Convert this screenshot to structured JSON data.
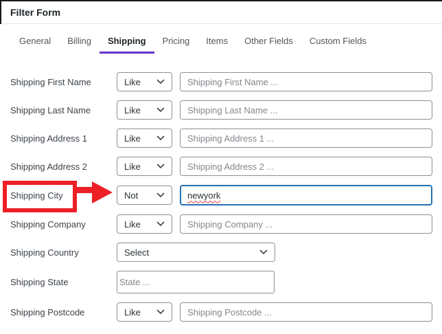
{
  "window": {
    "title": "Filter Form"
  },
  "tabs": [
    {
      "label": "General",
      "active": false
    },
    {
      "label": "Billing",
      "active": false
    },
    {
      "label": "Shipping",
      "active": true
    },
    {
      "label": "Pricing",
      "active": false
    },
    {
      "label": "Items",
      "active": false
    },
    {
      "label": "Other Fields",
      "active": false
    },
    {
      "label": "Custom Fields",
      "active": false
    }
  ],
  "form": {
    "rows": [
      {
        "label": "Shipping First Name",
        "operator": "Like",
        "placeholder": "Shipping First Name ..."
      },
      {
        "label": "Shipping Last Name",
        "operator": "Like",
        "placeholder": "Shipping Last Name ..."
      },
      {
        "label": "Shipping Address 1",
        "operator": "Like",
        "placeholder": "Shipping Address 1 ..."
      },
      {
        "label": "Shipping Address 2",
        "operator": "Like",
        "placeholder": "Shipping Address 2 ..."
      },
      {
        "label": "Shipping City",
        "operator": "Not",
        "value": "newyork"
      },
      {
        "label": "Shipping Company",
        "operator": "Like",
        "placeholder": "Shipping Company ..."
      },
      {
        "label": "Shipping Country",
        "selected": "Select"
      },
      {
        "label": "Shipping State",
        "placeholder": "State ..."
      },
      {
        "label": "Shipping Postcode",
        "operator": "Like",
        "placeholder": "Shipping Postcode ..."
      }
    ]
  },
  "annotation": {
    "type": "red-box-and-arrow",
    "target": "Shipping City",
    "color": "#ec2025"
  },
  "icons": {
    "chevron_down": "⌄"
  },
  "colors": {
    "active_tab_underline": "#6633cc",
    "focus_border": "#2271b1",
    "input_border": "#8c8f94"
  }
}
